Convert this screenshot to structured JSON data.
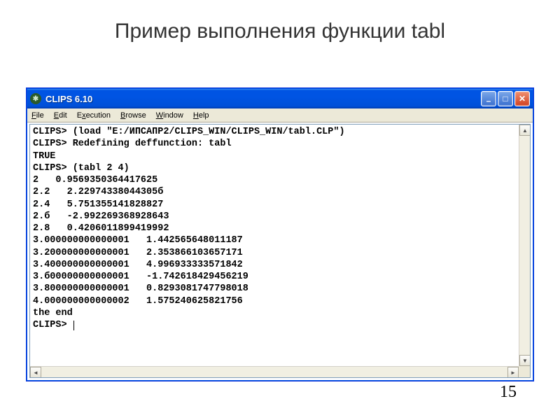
{
  "slide": {
    "title": "Пример выполнения функции tabl",
    "page_number": "15"
  },
  "window": {
    "title": "CLIPS 6.10",
    "icon_glyph": "✱",
    "buttons": {
      "minimize": "–",
      "maximize": "□",
      "close": "✕"
    }
  },
  "menu": {
    "items": [
      {
        "u": "F",
        "rest": "ile"
      },
      {
        "u": "E",
        "rest": "dit"
      },
      {
        "u": "",
        "rest": "E",
        "u2": "x",
        "rest2": "ecution"
      },
      {
        "u": "B",
        "rest": "rowse"
      },
      {
        "u": "W",
        "rest": "indow"
      },
      {
        "u": "H",
        "rest": "elp"
      }
    ],
    "file": "File",
    "edit": "Edit",
    "execution": "Execution",
    "browse": "Browse",
    "window_m": "Window",
    "help": "Help"
  },
  "console": {
    "lines": [
      "CLIPS> (load \"E:/ИПСАПР2/CLIPS_WIN/CLIPS_WIN/tabl.CLP\")",
      "CLIPS> Redefining deffunction: tabl",
      "TRUE",
      "CLIPS> (tabl 2 4)",
      "2   0.9569350364417625",
      "2.2   2.22974338044305б",
      "2.4   5.751355141828827",
      "2.б   -2.992269368928643",
      "2.8   0.4206011899419992",
      "3.000000000000001   1.442565648011187",
      "3.200000000000001   2.353866103657171",
      "3.400000000000001   4.996933333571842",
      "3.б00000000000001   -1.742618429456219",
      "3.800000000000001   0.8293081747798018",
      "4.000000000000002   1.575240625821756",
      "the end",
      "CLIPS> "
    ],
    "prompt": "CLIPS> "
  }
}
